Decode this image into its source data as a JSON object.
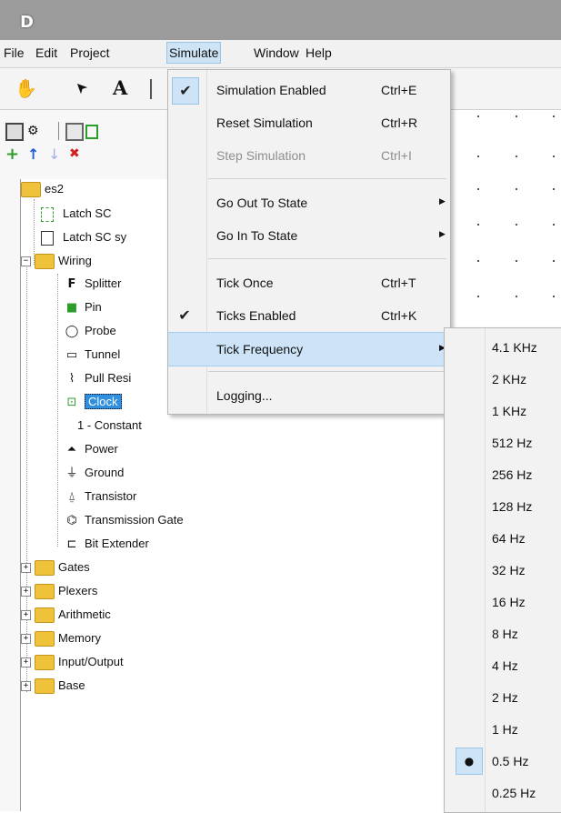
{
  "app": {
    "icon_glyph": "D"
  },
  "menubar": {
    "items": [
      {
        "label": "File"
      },
      {
        "label": "Edit"
      },
      {
        "label": "Project"
      },
      {
        "label": "Simulate"
      },
      {
        "label": "Window"
      },
      {
        "label": "Help"
      }
    ],
    "active": "Simulate"
  },
  "toolbar": {
    "tools": [
      {
        "icon": "hand-icon",
        "glyph": "✋"
      },
      {
        "icon": "arrow-pointer-icon",
        "glyph": "➤"
      },
      {
        "icon": "text-tool-icon",
        "glyph": "A"
      }
    ],
    "add_icon": "+",
    "up_icon": "↑",
    "down_icon": "↓",
    "delete_icon": "✖"
  },
  "tree": {
    "project": "es2",
    "circuits": [
      "Latch SC",
      "Latch SC sy"
    ],
    "wiring_folder": "Wiring",
    "wiring_items": [
      {
        "label": "Splitter",
        "glyph": "F"
      },
      {
        "label": "Pin",
        "glyph": "■"
      },
      {
        "label": "Probe",
        "glyph": "◯"
      },
      {
        "label": "Tunnel",
        "glyph": "▭"
      },
      {
        "label": "Pull Resi",
        "glyph": "⌇"
      },
      {
        "label": "Clock",
        "glyph": "⊡",
        "selected": true
      },
      {
        "label": "1 - Constant",
        "glyph": ""
      },
      {
        "label": "Power",
        "glyph": "⏶"
      },
      {
        "label": "Ground",
        "glyph": "⏚"
      },
      {
        "label": "Transistor",
        "glyph": "⍙"
      },
      {
        "label": "Transmission Gate",
        "glyph": "⌬"
      },
      {
        "label": "Bit Extender",
        "glyph": "⊏"
      }
    ],
    "folders": [
      "Gates",
      "Plexers",
      "Arithmetic",
      "Memory",
      "Input/Output",
      "Base"
    ]
  },
  "simulate_menu": {
    "items": [
      {
        "label": "Simulation Enabled",
        "shortcut": "Ctrl+E",
        "checked": true
      },
      {
        "label": "Reset Simulation",
        "shortcut": "Ctrl+R"
      },
      {
        "label": "Step Simulation",
        "shortcut": "Ctrl+I",
        "disabled": true
      },
      {
        "label": "Go Out To State",
        "submenu": true
      },
      {
        "label": "Go In To State",
        "submenu": true
      },
      {
        "label": "Tick Once",
        "shortcut": "Ctrl+T"
      },
      {
        "label": "Ticks Enabled",
        "shortcut": "Ctrl+K",
        "checked": true
      },
      {
        "label": "Tick Frequency",
        "submenu": true,
        "highlighted": true
      },
      {
        "label": "Logging..."
      }
    ],
    "check_glyph": "✔",
    "arrow_glyph": "▶"
  },
  "tick_frequency_menu": {
    "options": [
      "4.1 KHz",
      "2 KHz",
      "1 KHz",
      "512 Hz",
      "256 Hz",
      "128 Hz",
      "64 Hz",
      "32 Hz",
      "16 Hz",
      "8 Hz",
      "4 Hz",
      "2 Hz",
      "1 Hz",
      "0.5 Hz",
      "0.25 Hz"
    ],
    "selected": "0.5 Hz",
    "radio_glyph": "●"
  }
}
